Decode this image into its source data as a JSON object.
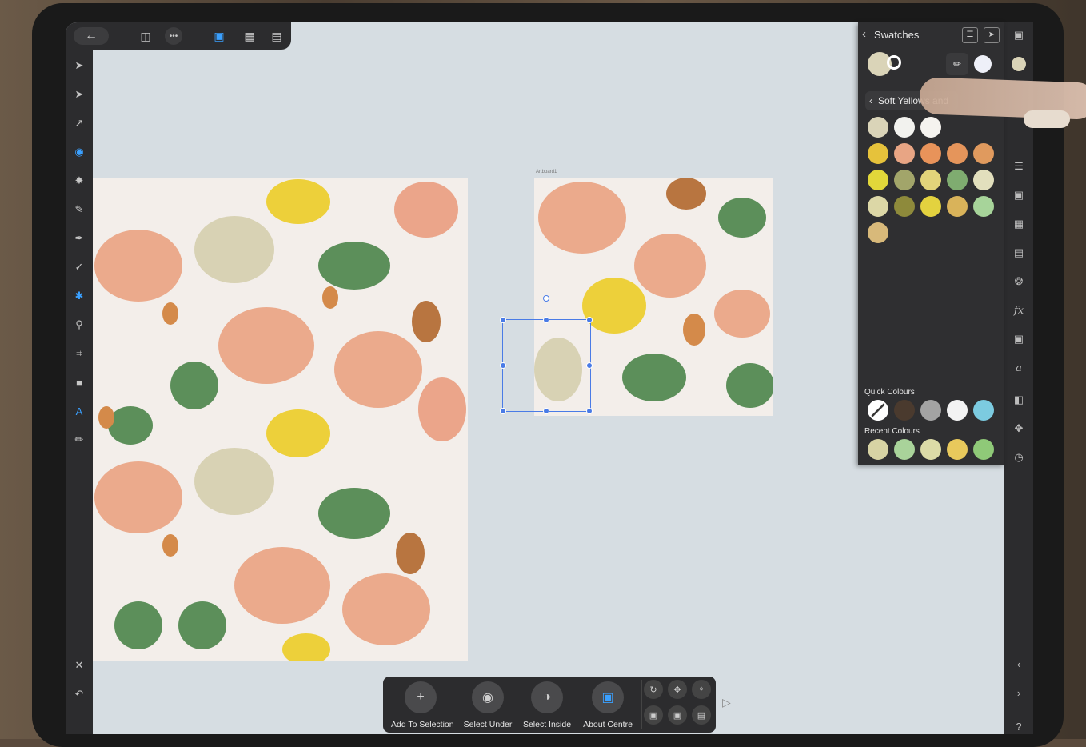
{
  "toolbar": {
    "icons": [
      "back-arrow-icon",
      "document-icon",
      "more-icon",
      "pixel-persona-icon",
      "grid-icon",
      "export-icon"
    ]
  },
  "left_tools": [
    "move-tool",
    "node-tool",
    "corner-tool",
    "pen-tool",
    "contour-tool",
    "pencil-tool",
    "vector-brush-tool",
    "fill-tool",
    "transparency-tool",
    "place-image-tool",
    "crop-tool",
    "shape-tool",
    "text-tool",
    "colour-picker-tool"
  ],
  "canvas": {
    "artboard_label": "Artboard1"
  },
  "swatches": {
    "title": "Swatches",
    "palette_name": "Soft Yellows and",
    "palette_colors": [
      "#dad4b8",
      "#f2f2ee",
      "#f5f3ef",
      "#e6c23b",
      "#e8a584",
      "#e8935a",
      "#e5955b",
      "#e09a5e",
      "#e1d73a",
      "#a2a56a",
      "#e2d47a",
      "#7fac70",
      "#e2dfbd",
      "#dcd7a6",
      "#8e8a3b",
      "#e3d23f",
      "#d9b35a",
      "#a7d49a",
      "#d8b97a"
    ],
    "quick_label": "Quick Colours",
    "quick_colors": [
      "none",
      "#4a3a2e",
      "#a3a3a3",
      "#f3f3f3",
      "#7ccbe0"
    ],
    "recent_label": "Recent Colours",
    "recent_colors": [
      "#d7d3a4",
      "#a9d39a",
      "#dcdba7",
      "#e8c95c",
      "#8fc978"
    ],
    "fill_color": "#dad4b8",
    "stroke_color": "#ffffff",
    "extra_color": "#eef0f8"
  },
  "context": {
    "add_label": "Add To Selection",
    "under_label": "Select Under",
    "inside_label": "Select Inside",
    "centre_label": "About Centre"
  },
  "accent": "#3aa0ff"
}
